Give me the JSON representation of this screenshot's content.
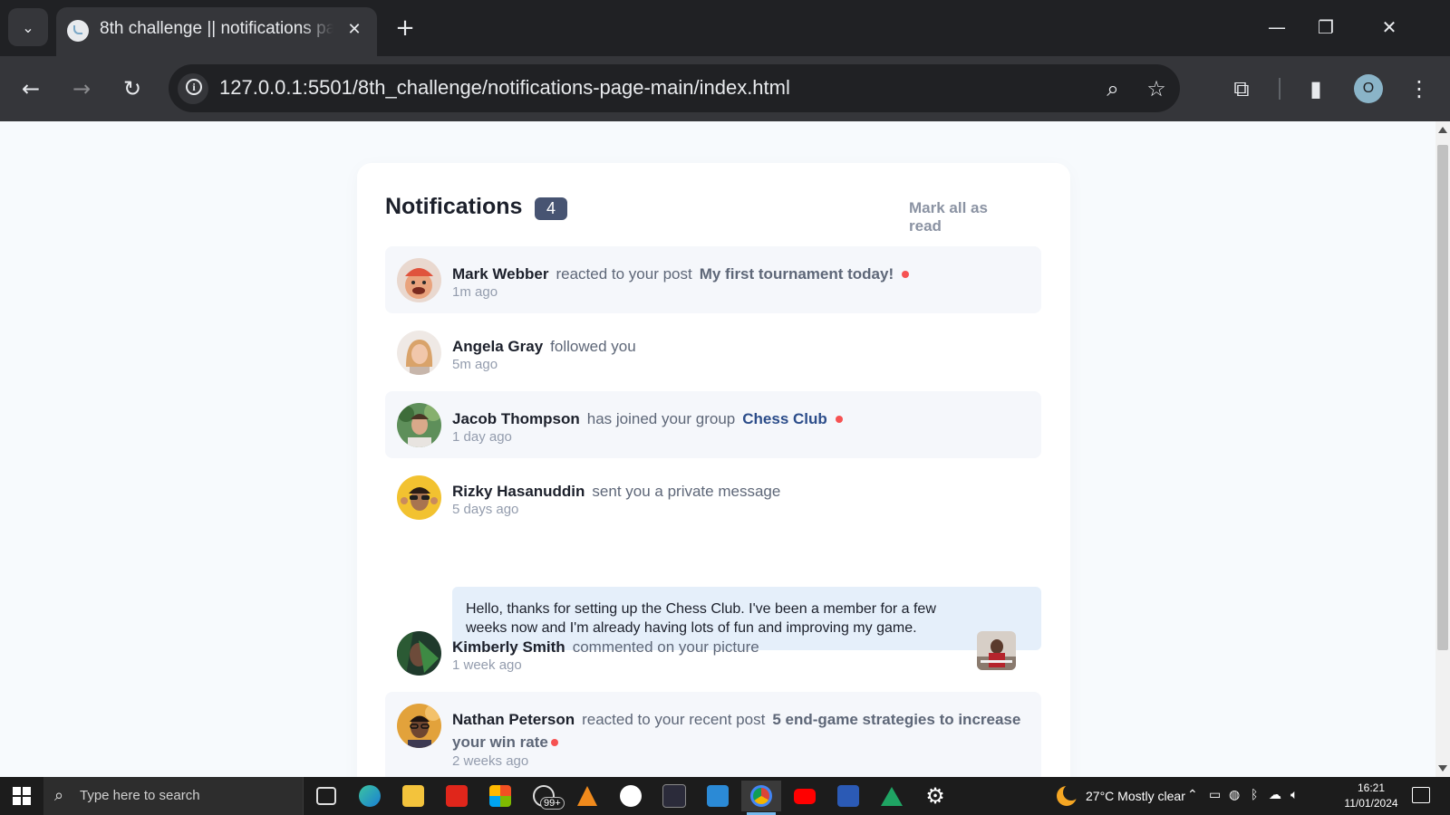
{
  "browser": {
    "tab_title": "8th challenge || notifications page",
    "url": "127.0.0.1:5501/8th_challenge/notifications-page-main/index.html",
    "profile_initial": "O"
  },
  "page": {
    "title": "Notifications",
    "unread_count": "4",
    "mark_all_label": "Mark all as read",
    "notifications": [
      {
        "name": "Mark Webber",
        "action": "reacted to your post",
        "target": "My first tournament today!",
        "time": "1m ago",
        "unread": true
      },
      {
        "name": "Angela Gray",
        "action": "followed you",
        "target": "",
        "time": "5m ago",
        "unread": false
      },
      {
        "name": "Jacob Thompson",
        "action": "has joined your group",
        "target": "Chess Club",
        "time": "1 day ago",
        "unread": true
      },
      {
        "name": "Rizky Hasanuddin",
        "action": "sent you a private message",
        "target": "",
        "time": "5 days ago",
        "unread": false,
        "message": "Hello, thanks for setting up the Chess Club. I've been a member for a few weeks now and I'm already having lots of fun and improving my game."
      },
      {
        "name": "Kimberly Smith",
        "action": "commented on your picture",
        "target": "",
        "time": "1 week ago",
        "unread": false
      },
      {
        "name": "Nathan Peterson",
        "action": "reacted to your recent post",
        "target": "5 end-game strategies to increase",
        "target_line2": "your win rate",
        "time": "2 weeks ago",
        "unread": true
      }
    ]
  },
  "taskbar": {
    "search_placeholder": "Type here to search",
    "whatsapp_badge": "99+",
    "weather": "27°C  Mostly clear",
    "time": "16:21",
    "date": "11/01/2024"
  },
  "colors": {
    "accent_red": "#f65252",
    "title": "#1c202b",
    "muted": "#5e6778",
    "unread_bg": "#f5f7fb"
  }
}
